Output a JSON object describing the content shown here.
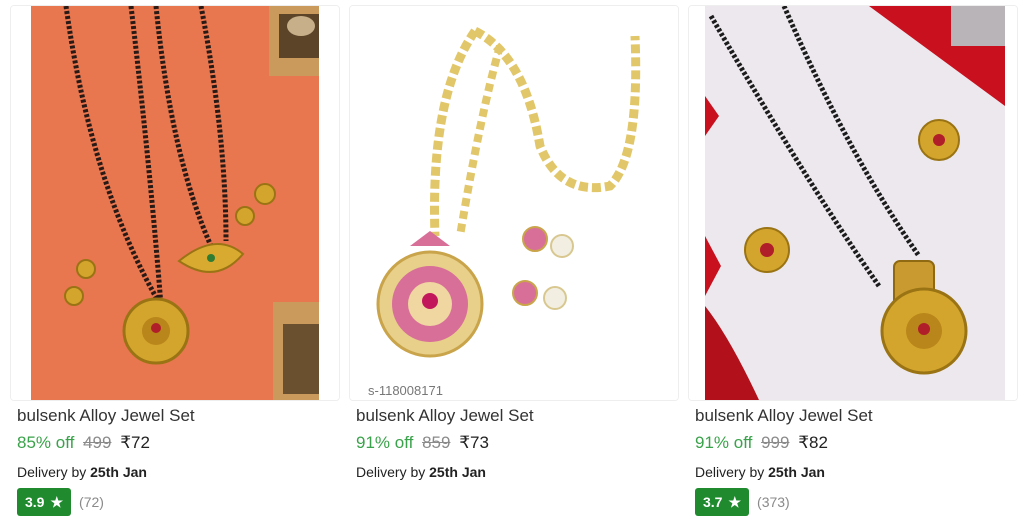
{
  "products": [
    {
      "title": "bulsenk Alloy Jewel Set",
      "discount": "85% off",
      "mrp": "499",
      "price": "₹72",
      "delivery_prefix": "Delivery by",
      "delivery_date": "25th Jan",
      "rating": "3.9",
      "rating_count": "(72)",
      "image_desc": "Gold mangalsutra sets with earrings on orange background"
    },
    {
      "title": "bulsenk Alloy Jewel Set",
      "discount": "91% off",
      "mrp": "859",
      "price": "₹73",
      "delivery_prefix": "Delivery by",
      "delivery_date": "25th Jan",
      "watermark": "s-118008171",
      "image_desc": "Kundan pink stone necklace set with earrings on white background"
    },
    {
      "title": "bulsenk Alloy Jewel Set",
      "discount": "91% off",
      "mrp": "999",
      "price": "₹82",
      "delivery_prefix": "Delivery by",
      "delivery_date": "25th Jan",
      "rating": "3.7",
      "rating_count": "(373)",
      "image_desc": "Gold mangalsutra with round pendant and stud earrings on light background"
    }
  ],
  "colors": {
    "discount": "#3aa24a",
    "rating_badge": "#1f8a2e",
    "strikethrough": "#8a8a8a"
  },
  "icons": {
    "rating": "star-icon"
  }
}
